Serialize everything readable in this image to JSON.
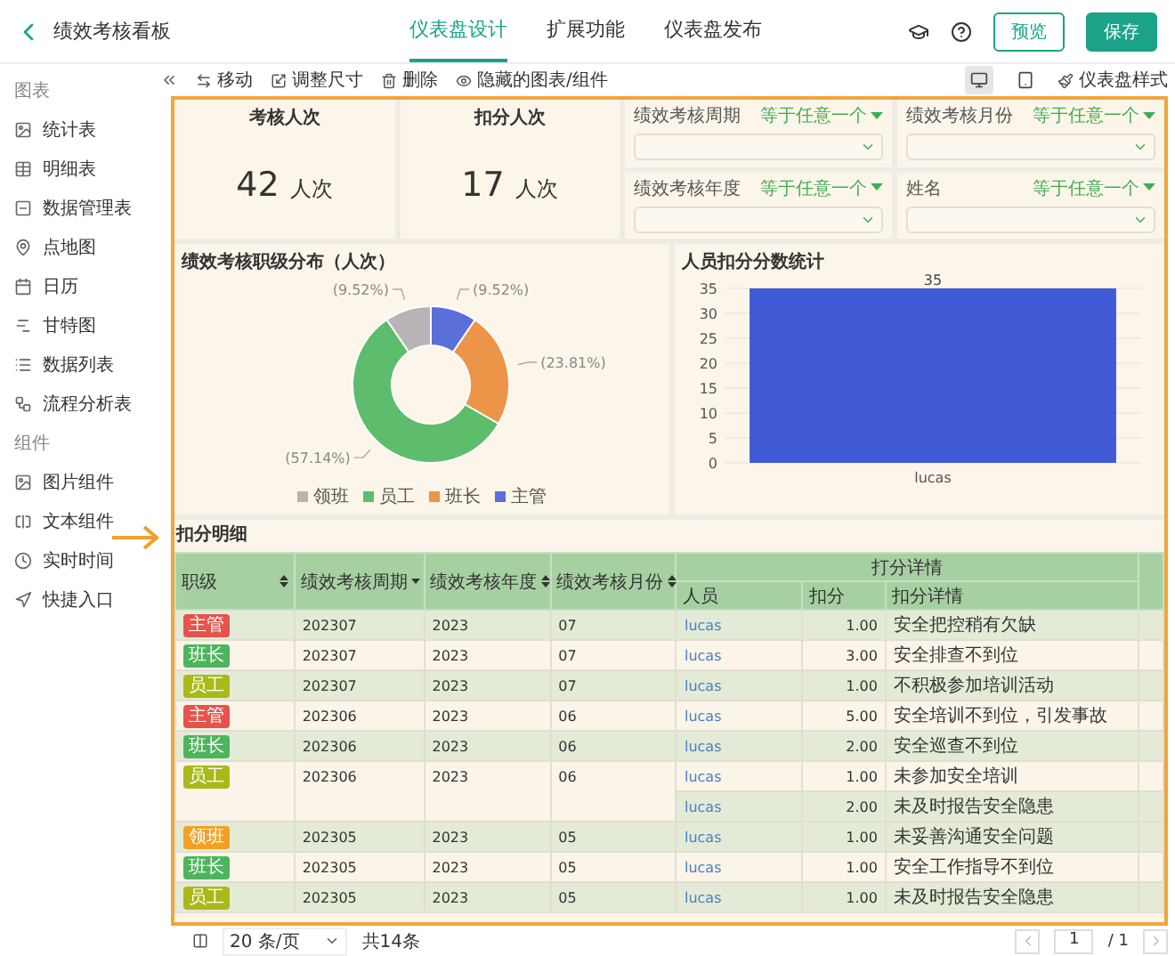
{
  "header": {
    "title": "绩效考核看板",
    "tabs": [
      {
        "label": "仪表盘设计",
        "selected": true
      },
      {
        "label": "扩展功能",
        "selected": false
      },
      {
        "label": "仪表盘发布",
        "selected": false
      }
    ],
    "buttons": [
      {
        "label": "预览",
        "kind": "outline"
      },
      {
        "label": "保存",
        "kind": "primary"
      }
    ]
  },
  "toolbar": {
    "actions": [
      "移动",
      "调整尺寸",
      "删除",
      "隐藏的图表/组件"
    ],
    "devices": [
      {
        "kind": "desktop",
        "selected": true
      },
      {
        "kind": "tablet",
        "selected": false
      }
    ],
    "style_button": "仪表盘样式"
  },
  "sidebar": {
    "sections": [
      {
        "title": "图表",
        "items": [
          "统计表",
          "明细表",
          "数据管理表",
          "点地图",
          "日历",
          "甘特图",
          "数据列表",
          "流程分析表"
        ]
      },
      {
        "title": "组件",
        "items": [
          "图片组件",
          "文本组件",
          "实时时间",
          "快捷入口"
        ]
      }
    ]
  },
  "kpis": [
    {
      "title": "考核人次",
      "value": "42",
      "unit": "人次"
    },
    {
      "title": "扣分人次",
      "value": "17",
      "unit": "人次"
    }
  ],
  "filters": [
    {
      "label": "绩效考核周期",
      "operator": "等于任意一个"
    },
    {
      "label": "绩效考核月份",
      "operator": "等于任意一个"
    },
    {
      "label": "绩效考核年度",
      "operator": "等于任意一个"
    },
    {
      "label": "姓名",
      "operator": "等于任意一个"
    }
  ],
  "pie_chart": {
    "chart_data": {
      "type": "donut",
      "title": "绩效考核职级分布（人次）",
      "categories": [
        "领班",
        "员工",
        "班长",
        "主管"
      ],
      "values": [
        9.52,
        57.14,
        23.81,
        9.52
      ],
      "colors": [
        "#b7b3b6",
        "#5dbd6c",
        "#ec9447",
        "#5a6fd8"
      ],
      "value_labels": [
        "(9.52%)",
        "(57.14%)",
        "(23.81%)",
        "(9.52%)"
      ]
    }
  },
  "bar_chart": {
    "chart_data": {
      "type": "bar",
      "title": "人员扣分分数统计",
      "categories": [
        "lucas"
      ],
      "series": [
        {
          "color": "#4059d4",
          "values": [
            35
          ]
        }
      ],
      "ylim": [
        0,
        35
      ],
      "grid": true,
      "yticks": [
        0,
        5,
        10,
        15,
        20,
        25,
        30,
        35
      ],
      "data_labels": true
    }
  },
  "table": {
    "title": "扣分明细",
    "columns": [
      {
        "label": "职级",
        "sorted": false
      },
      {
        "label": "绩效考核周期",
        "sorted": true
      },
      {
        "label": "绩效考核年度",
        "sorted": false
      },
      {
        "label": "绩效考核月份",
        "sorted": false
      }
    ],
    "group_label": "打分详情",
    "sub_columns": [
      "人员",
      "扣分",
      "扣分详情"
    ],
    "rows": [
      {
        "level": "主管",
        "color": "#e5534b",
        "period": "202307",
        "year": "2023",
        "month": "07",
        "details": [
          {
            "person": "lucas",
            "score": "1.00",
            "detail": "安全把控稍有欠缺"
          }
        ]
      },
      {
        "level": "班长",
        "color": "#4db45e",
        "period": "202307",
        "year": "2023",
        "month": "07",
        "details": [
          {
            "person": "lucas",
            "score": "3.00",
            "detail": "安全排查不到位"
          }
        ]
      },
      {
        "level": "员工",
        "color": "#a9b91a",
        "period": "202307",
        "year": "2023",
        "month": "07",
        "details": [
          {
            "person": "lucas",
            "score": "1.00",
            "detail": "不积极参加培训活动"
          }
        ]
      },
      {
        "level": "主管",
        "color": "#e5534b",
        "period": "202306",
        "year": "2023",
        "month": "06",
        "details": [
          {
            "person": "lucas",
            "score": "5.00",
            "detail": "安全培训不到位，引发事故"
          }
        ]
      },
      {
        "level": "班长",
        "color": "#4db45e",
        "period": "202306",
        "year": "2023",
        "month": "06",
        "details": [
          {
            "person": "lucas",
            "score": "2.00",
            "detail": "安全巡查不到位"
          }
        ]
      },
      {
        "level": "员工",
        "color": "#a9b91a",
        "period": "202306",
        "year": "2023",
        "month": "06",
        "details": [
          {
            "person": "lucas",
            "score": "1.00",
            "detail": "未参加安全培训"
          },
          {
            "person": "lucas",
            "score": "2.00",
            "detail": "未及时报告安全隐患"
          }
        ]
      },
      {
        "level": "领班",
        "color": "#f2a024",
        "period": "202305",
        "year": "2023",
        "month": "05",
        "details": [
          {
            "person": "lucas",
            "score": "1.00",
            "detail": "未妥善沟通安全问题"
          }
        ]
      },
      {
        "level": "班长",
        "color": "#4db45e",
        "period": "202305",
        "year": "2023",
        "month": "05",
        "details": [
          {
            "person": "lucas",
            "score": "1.00",
            "detail": "安全工作指导不到位"
          }
        ]
      },
      {
        "level": "员工",
        "color": "#a9b91a",
        "period": "202305",
        "year": "2023",
        "month": "05",
        "details": [
          {
            "person": "lucas",
            "score": "1.00",
            "detail": "未及时报告安全隐患"
          }
        ]
      }
    ]
  },
  "pagination": {
    "page_size": "20 条/页",
    "total": "共14条",
    "page": "1",
    "pages": "/ 1"
  }
}
